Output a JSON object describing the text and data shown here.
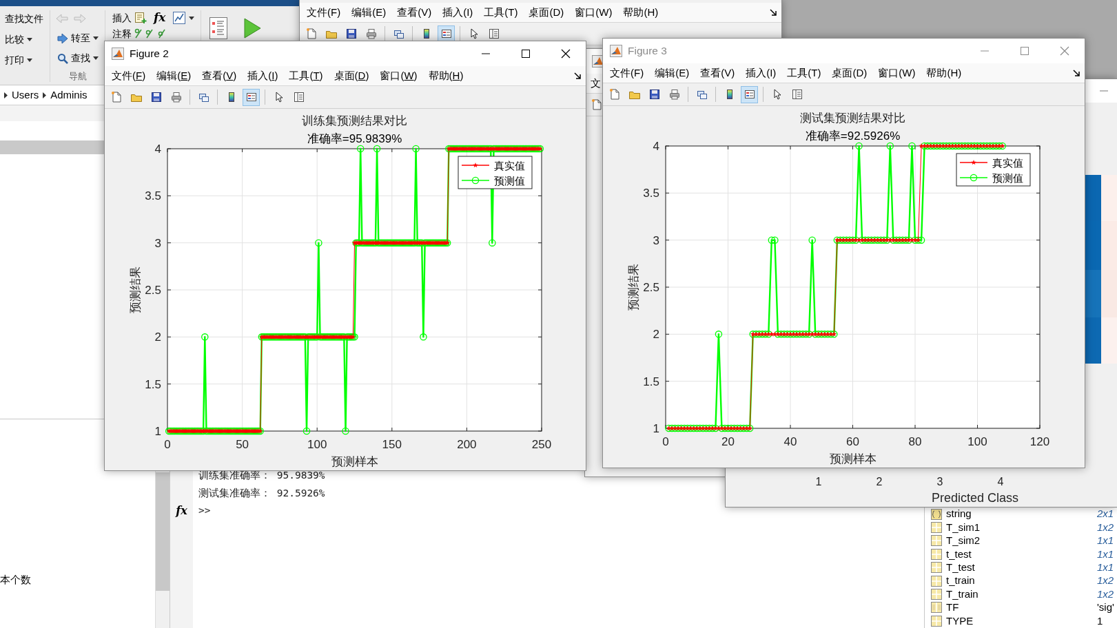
{
  "ribbon": {
    "file_buttons": [
      {
        "label": "查找文件",
        "dropdown": false
      },
      {
        "label": "比较",
        "dropdown": true
      },
      {
        "label": "打印",
        "dropdown": true
      }
    ],
    "nav_buttons": [
      {
        "label": "转至",
        "dropdown": true
      },
      {
        "label": "查找",
        "dropdown": true
      }
    ],
    "nav_group_label": "导航",
    "code_buttons": [
      {
        "label": "插入"
      },
      {
        "label": "注释"
      }
    ],
    "fx": "fx"
  },
  "folder_panel": {
    "path": [
      "Users",
      "Adminis"
    ],
    "item_fragment": "本个数"
  },
  "command_window": {
    "lines": [
      "训练集准确率： 95.9839%",
      "测试集准确率： 92.5926%"
    ],
    "fx": "fx",
    "prompt": ">>"
  },
  "workspace": {
    "rows": [
      {
        "kind": "cell",
        "name": "string",
        "value": "2x1",
        "summary": true
      },
      {
        "kind": "matrix",
        "name": "T_sim1",
        "value": "1x2",
        "summary": true
      },
      {
        "kind": "matrix",
        "name": "T_sim2",
        "value": "1x1",
        "summary": true
      },
      {
        "kind": "matrix",
        "name": "t_test",
        "value": "1x1",
        "summary": true
      },
      {
        "kind": "matrix",
        "name": "T_test",
        "value": "1x1",
        "summary": true
      },
      {
        "kind": "matrix",
        "name": "t_train",
        "value": "1x2",
        "summary": true
      },
      {
        "kind": "matrix",
        "name": "T_train",
        "value": "1x2",
        "summary": true
      },
      {
        "kind": "char",
        "name": "TF",
        "value": "'sig'",
        "summary": false
      },
      {
        "kind": "matrix",
        "name": "TYPE",
        "value": "1",
        "summary": false
      }
    ]
  },
  "back_window": {
    "menu_underline": false,
    "menu": [
      "文件(F)",
      "编辑(E)",
      "查看(V)",
      "插入(I)",
      "工具(T)",
      "桌面(D)",
      "窗口(W)",
      "帮助(H)"
    ],
    "toolbar": [
      [
        {
          "kind": "new",
          "pressed": false
        },
        {
          "kind": "open",
          "pressed": false
        },
        {
          "kind": "save",
          "pressed": false
        },
        {
          "kind": "print",
          "pressed": false
        }
      ],
      [
        {
          "kind": "link",
          "pressed": false
        }
      ],
      [
        {
          "kind": "colorbar",
          "pressed": false
        },
        {
          "kind": "legend",
          "pressed": true
        }
      ],
      [
        {
          "kind": "pointer",
          "pressed": false
        },
        {
          "kind": "inspector",
          "pressed": false
        }
      ]
    ]
  },
  "middle_window": {
    "menu_fragment": "文",
    "toolbar": [
      [
        {
          "kind": "new",
          "pressed": false
        }
      ]
    ]
  },
  "confusion_window": {
    "cells": [
      [
        {
          "color": "#0b67b1"
        },
        {
          "color": "#fcf0ec"
        }
      ],
      [
        {
          "color": "#0a68b2"
        },
        {
          "color": "#fbebe6"
        }
      ],
      [
        {
          "color": "#1673b9"
        },
        {
          "color": "#f9e9e4"
        }
      ],
      [
        {
          "color": "#0d69b2"
        },
        {
          "color": "#fcf1ee"
        }
      ]
    ],
    "x_ticks": [
      "1",
      "2",
      "3",
      "4"
    ],
    "xlabel": "Predicted Class"
  },
  "figures": [
    {
      "title": "Figure 2",
      "active": true,
      "menu_underline": true,
      "menu": [
        "文件(F)",
        "编辑(E)",
        "查看(V)",
        "插入(I)",
        "工具(T)",
        "桌面(D)",
        "窗口(W)",
        "帮助(H)"
      ],
      "toolbar": [
        [
          {
            "kind": "new",
            "pressed": false
          },
          {
            "kind": "open",
            "pressed": false
          },
          {
            "kind": "save",
            "pressed": false
          },
          {
            "kind": "print",
            "pressed": false
          }
        ],
        [
          {
            "kind": "link",
            "pressed": false
          }
        ],
        [
          {
            "kind": "colorbar",
            "pressed": false
          },
          {
            "kind": "legend",
            "pressed": true
          }
        ],
        [
          {
            "kind": "pointer",
            "pressed": false
          },
          {
            "kind": "inspector",
            "pressed": false
          }
        ]
      ],
      "chart_data": {
        "type": "line",
        "title": [
          "训练集预测结果对比",
          "准确率=95.9839%"
        ],
        "xlabel": "预测样本",
        "ylabel": "预测结果",
        "grid": true,
        "legend": true,
        "xlim": [
          0,
          250
        ],
        "ylim": [
          1,
          4
        ],
        "xticks": [
          {
            "value": 0,
            "label": "0"
          },
          {
            "value": 50,
            "label": "50"
          },
          {
            "value": 100,
            "label": "100"
          },
          {
            "value": 150,
            "label": "150"
          },
          {
            "value": 200,
            "label": "200"
          },
          {
            "value": 250,
            "label": "250"
          }
        ],
        "yticks": [
          {
            "value": 1,
            "label": "1"
          },
          {
            "value": 1.5,
            "label": "1.5"
          },
          {
            "value": 2,
            "label": "2"
          },
          {
            "value": 2.5,
            "label": "2.5"
          },
          {
            "value": 3,
            "label": "3"
          },
          {
            "value": 3.5,
            "label": "3.5"
          },
          {
            "value": 4,
            "label": "4"
          }
        ],
        "x": [
          1,
          2,
          3,
          4,
          5,
          6,
          7,
          8,
          9,
          10,
          11,
          12,
          13,
          14,
          15,
          16,
          17,
          18,
          19,
          20,
          21,
          22,
          23,
          24,
          25,
          26,
          27,
          28,
          29,
          30,
          31,
          32,
          33,
          34,
          35,
          36,
          37,
          38,
          39,
          40,
          41,
          42,
          43,
          44,
          45,
          46,
          47,
          48,
          49,
          50,
          51,
          52,
          53,
          54,
          55,
          56,
          57,
          58,
          59,
          60,
          61,
          62,
          63,
          64,
          65,
          66,
          67,
          68,
          69,
          70,
          71,
          72,
          73,
          74,
          75,
          76,
          77,
          78,
          79,
          80,
          81,
          82,
          83,
          84,
          85,
          86,
          87,
          88,
          89,
          90,
          91,
          92,
          93,
          94,
          95,
          96,
          97,
          98,
          99,
          100,
          101,
          102,
          103,
          104,
          105,
          106,
          107,
          108,
          109,
          110,
          111,
          112,
          113,
          114,
          115,
          116,
          117,
          118,
          119,
          120,
          121,
          122,
          123,
          124,
          125,
          126,
          127,
          128,
          129,
          130,
          131,
          132,
          133,
          134,
          135,
          136,
          137,
          138,
          139,
          140,
          141,
          142,
          143,
          144,
          145,
          146,
          147,
          148,
          149,
          150,
          151,
          152,
          153,
          154,
          155,
          156,
          157,
          158,
          159,
          160,
          161,
          162,
          163,
          164,
          165,
          166,
          167,
          168,
          169,
          170,
          171,
          172,
          173,
          174,
          175,
          176,
          177,
          178,
          179,
          180,
          181,
          182,
          183,
          184,
          185,
          186,
          187,
          188,
          189,
          190,
          191,
          192,
          193,
          194,
          195,
          196,
          197,
          198,
          199,
          200,
          201,
          202,
          203,
          204,
          205,
          206,
          207,
          208,
          209,
          210,
          211,
          212,
          213,
          214,
          215,
          216,
          217,
          218,
          219,
          220,
          221,
          222,
          223,
          224,
          225,
          226,
          227,
          228,
          229,
          230,
          231,
          232,
          233,
          234,
          235,
          236,
          237,
          238,
          239,
          240,
          241,
          242,
          243,
          244,
          245,
          246,
          247,
          248,
          249
        ],
        "series": [
          {
            "name": "真实值",
            "color": "#ff0000",
            "marker": "star",
            "values": [
              1,
              1,
              1,
              1,
              1,
              1,
              1,
              1,
              1,
              1,
              1,
              1,
              1,
              1,
              1,
              1,
              1,
              1,
              1,
              1,
              1,
              1,
              1,
              1,
              1,
              1,
              1,
              1,
              1,
              1,
              1,
              1,
              1,
              1,
              1,
              1,
              1,
              1,
              1,
              1,
              1,
              1,
              1,
              1,
              1,
              1,
              1,
              1,
              1,
              1,
              1,
              1,
              1,
              1,
              1,
              1,
              1,
              1,
              1,
              1,
              1,
              1,
              2,
              2,
              2,
              2,
              2,
              2,
              2,
              2,
              2,
              2,
              2,
              2,
              2,
              2,
              2,
              2,
              2,
              2,
              2,
              2,
              2,
              2,
              2,
              2,
              2,
              2,
              2,
              2,
              2,
              2,
              2,
              2,
              2,
              2,
              2,
              2,
              2,
              2,
              2,
              2,
              2,
              2,
              2,
              2,
              2,
              2,
              2,
              2,
              2,
              2,
              2,
              2,
              2,
              2,
              2,
              2,
              2,
              2,
              2,
              2,
              2,
              2,
              3,
              3,
              3,
              3,
              3,
              3,
              3,
              3,
              3,
              3,
              3,
              3,
              3,
              3,
              3,
              3,
              3,
              3,
              3,
              3,
              3,
              3,
              3,
              3,
              3,
              3,
              3,
              3,
              3,
              3,
              3,
              3,
              3,
              3,
              3,
              3,
              3,
              3,
              3,
              3,
              3,
              3,
              3,
              3,
              3,
              3,
              3,
              3,
              3,
              3,
              3,
              3,
              3,
              3,
              3,
              3,
              3,
              3,
              3,
              3,
              3,
              3,
              3,
              4,
              4,
              4,
              4,
              4,
              4,
              4,
              4,
              4,
              4,
              4,
              4,
              4,
              4,
              4,
              4,
              4,
              4,
              4,
              4,
              4,
              4,
              4,
              4,
              4,
              4,
              4,
              4,
              4,
              4,
              4,
              4,
              4,
              4,
              4,
              4,
              4,
              4,
              4,
              4,
              4,
              4,
              4,
              4,
              4,
              4,
              4,
              4,
              4,
              4,
              4,
              4,
              4,
              4,
              4,
              4,
              4,
              4,
              4,
              4,
              4,
              4
            ]
          },
          {
            "name": "预测值",
            "color": "#00ff00",
            "marker": "circle",
            "values": [
              1,
              1,
              1,
              1,
              1,
              1,
              1,
              1,
              1,
              1,
              1,
              1,
              1,
              1,
              1,
              1,
              1,
              1,
              1,
              1,
              1,
              1,
              1,
              1,
              2,
              1,
              1,
              1,
              1,
              1,
              1,
              1,
              1,
              1,
              1,
              1,
              1,
              1,
              1,
              1,
              1,
              1,
              1,
              1,
              1,
              1,
              1,
              1,
              1,
              1,
              1,
              1,
              1,
              1,
              1,
              1,
              1,
              1,
              1,
              1,
              1,
              1,
              2,
              2,
              2,
              2,
              2,
              2,
              2,
              2,
              2,
              2,
              2,
              2,
              2,
              2,
              2,
              2,
              2,
              2,
              2,
              2,
              2,
              2,
              2,
              2,
              2,
              2,
              2,
              2,
              2,
              2,
              1,
              2,
              2,
              2,
              2,
              2,
              2,
              2,
              3,
              2,
              2,
              2,
              2,
              2,
              2,
              2,
              2,
              2,
              2,
              2,
              2,
              2,
              2,
              2,
              2,
              2,
              1,
              2,
              2,
              2,
              2,
              2,
              2,
              3,
              3,
              3,
              4,
              3,
              3,
              3,
              3,
              3,
              3,
              3,
              3,
              3,
              3,
              4,
              3,
              3,
              3,
              3,
              3,
              3,
              3,
              3,
              3,
              3,
              3,
              3,
              3,
              3,
              3,
              3,
              3,
              3,
              3,
              3,
              3,
              3,
              3,
              3,
              3,
              4,
              3,
              3,
              3,
              3,
              2,
              3,
              3,
              3,
              3,
              3,
              3,
              3,
              3,
              3,
              3,
              3,
              3,
              3,
              3,
              3,
              3,
              4,
              4,
              4,
              4,
              4,
              4,
              4,
              4,
              4,
              4,
              4,
              4,
              4,
              4,
              4,
              4,
              4,
              4,
              4,
              4,
              4,
              4,
              4,
              4,
              4,
              4,
              4,
              4,
              4,
              3,
              4,
              4,
              4,
              4,
              4,
              4,
              4,
              4,
              4,
              4,
              4,
              4,
              4,
              4,
              4,
              4,
              4,
              4,
              4,
              4,
              4,
              4,
              4,
              4,
              4,
              4,
              4,
              4,
              4,
              4,
              4,
              4
            ]
          }
        ]
      }
    },
    {
      "title": "Figure 3",
      "active": false,
      "menu_underline": false,
      "menu": [
        "文件(F)",
        "编辑(E)",
        "查看(V)",
        "插入(I)",
        "工具(T)",
        "桌面(D)",
        "窗口(W)",
        "帮助(H)"
      ],
      "toolbar": [
        [
          {
            "kind": "new",
            "pressed": false
          },
          {
            "kind": "open",
            "pressed": false
          },
          {
            "kind": "save",
            "pressed": false
          },
          {
            "kind": "print",
            "pressed": false
          }
        ],
        [
          {
            "kind": "link",
            "pressed": false
          }
        ],
        [
          {
            "kind": "colorbar",
            "pressed": false
          },
          {
            "kind": "legend",
            "pressed": true
          }
        ],
        [
          {
            "kind": "pointer",
            "pressed": false
          },
          {
            "kind": "inspector",
            "pressed": false
          }
        ]
      ],
      "chart_data": {
        "type": "line",
        "title": [
          "测试集预测结果对比",
          "准确率=92.5926%"
        ],
        "xlabel": "预测样本",
        "ylabel": "预测结果",
        "grid": true,
        "legend": true,
        "xlim": [
          0,
          120
        ],
        "ylim": [
          1,
          4
        ],
        "xticks": [
          {
            "value": 0,
            "label": "0"
          },
          {
            "value": 20,
            "label": "20"
          },
          {
            "value": 40,
            "label": "40"
          },
          {
            "value": 60,
            "label": "60"
          },
          {
            "value": 80,
            "label": "80"
          },
          {
            "value": 100,
            "label": "100"
          },
          {
            "value": 120,
            "label": "120"
          }
        ],
        "yticks": [
          {
            "value": 1,
            "label": "1"
          },
          {
            "value": 1.5,
            "label": "1.5"
          },
          {
            "value": 2,
            "label": "2"
          },
          {
            "value": 2.5,
            "label": "2.5"
          },
          {
            "value": 3,
            "label": "3"
          },
          {
            "value": 3.5,
            "label": "3.5"
          },
          {
            "value": 4,
            "label": "4"
          }
        ],
        "x": [
          1,
          2,
          3,
          4,
          5,
          6,
          7,
          8,
          9,
          10,
          11,
          12,
          13,
          14,
          15,
          16,
          17,
          18,
          19,
          20,
          21,
          22,
          23,
          24,
          25,
          26,
          27,
          28,
          29,
          30,
          31,
          32,
          33,
          34,
          35,
          36,
          37,
          38,
          39,
          40,
          41,
          42,
          43,
          44,
          45,
          46,
          47,
          48,
          49,
          50,
          51,
          52,
          53,
          54,
          55,
          56,
          57,
          58,
          59,
          60,
          61,
          62,
          63,
          64,
          65,
          66,
          67,
          68,
          69,
          70,
          71,
          72,
          73,
          74,
          75,
          76,
          77,
          78,
          79,
          80,
          81,
          82,
          83,
          84,
          85,
          86,
          87,
          88,
          89,
          90,
          91,
          92,
          93,
          94,
          95,
          96,
          97,
          98,
          99,
          100,
          101,
          102,
          103,
          104,
          105,
          106,
          107,
          108
        ],
        "series": [
          {
            "name": "真实值",
            "color": "#ff0000",
            "marker": "star",
            "values": [
              1,
              1,
              1,
              1,
              1,
              1,
              1,
              1,
              1,
              1,
              1,
              1,
              1,
              1,
              1,
              1,
              1,
              1,
              1,
              1,
              1,
              1,
              1,
              1,
              1,
              1,
              1,
              2,
              2,
              2,
              2,
              2,
              2,
              2,
              2,
              2,
              2,
              2,
              2,
              2,
              2,
              2,
              2,
              2,
              2,
              2,
              2,
              2,
              2,
              2,
              2,
              2,
              2,
              2,
              3,
              3,
              3,
              3,
              3,
              3,
              3,
              3,
              3,
              3,
              3,
              3,
              3,
              3,
              3,
              3,
              3,
              3,
              3,
              3,
              3,
              3,
              3,
              3,
              3,
              3,
              3,
              4,
              4,
              4,
              4,
              4,
              4,
              4,
              4,
              4,
              4,
              4,
              4,
              4,
              4,
              4,
              4,
              4,
              4,
              4,
              4,
              4,
              4,
              4,
              4,
              4,
              4,
              4
            ]
          },
          {
            "name": "预测值",
            "color": "#00ff00",
            "marker": "circle",
            "values": [
              1,
              1,
              1,
              1,
              1,
              1,
              1,
              1,
              1,
              1,
              1,
              1,
              1,
              1,
              1,
              1,
              2,
              1,
              1,
              1,
              1,
              1,
              1,
              1,
              1,
              1,
              1,
              2,
              2,
              2,
              2,
              2,
              2,
              3,
              3,
              2,
              2,
              2,
              2,
              2,
              2,
              2,
              2,
              2,
              2,
              2,
              3,
              2,
              2,
              2,
              2,
              2,
              2,
              2,
              3,
              3,
              3,
              3,
              3,
              3,
              3,
              4,
              3,
              3,
              3,
              3,
              3,
              3,
              3,
              3,
              3,
              4,
              3,
              3,
              3,
              3,
              3,
              3,
              4,
              3,
              3,
              3,
              4,
              4,
              4,
              4,
              4,
              4,
              4,
              4,
              4,
              4,
              4,
              4,
              4,
              4,
              4,
              4,
              4,
              4,
              4,
              4,
              4,
              4,
              4,
              4,
              4,
              4
            ]
          }
        ]
      }
    }
  ]
}
